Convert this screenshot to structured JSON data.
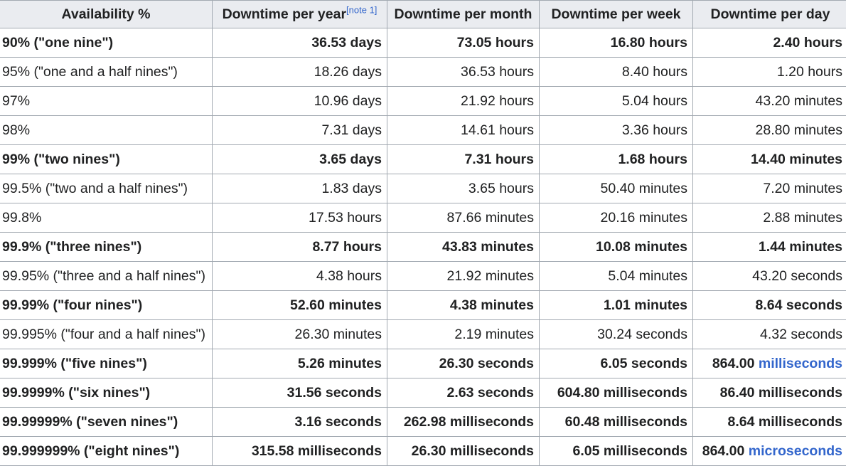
{
  "headers": [
    "Availability %",
    "Downtime per year",
    "Downtime per month",
    "Downtime per week",
    "Downtime per day"
  ],
  "note_ref": "[note 1]",
  "rows": [
    {
      "bold": true,
      "cells": [
        "90% (\"one nine\")",
        "36.53 days",
        "73.05 hours",
        "16.80 hours",
        "2.40 hours"
      ]
    },
    {
      "bold": false,
      "cells": [
        "95% (\"one and a half nines\")",
        "18.26 days",
        "36.53 hours",
        "8.40 hours",
        "1.20 hours"
      ]
    },
    {
      "bold": false,
      "cells": [
        "97%",
        "10.96 days",
        "21.92 hours",
        "5.04 hours",
        "43.20 minutes"
      ]
    },
    {
      "bold": false,
      "cells": [
        "98%",
        "7.31 days",
        "14.61 hours",
        "3.36 hours",
        "28.80 minutes"
      ]
    },
    {
      "bold": true,
      "cells": [
        "99% (\"two nines\")",
        "3.65 days",
        "7.31 hours",
        "1.68 hours",
        "14.40 minutes"
      ]
    },
    {
      "bold": false,
      "cells": [
        "99.5% (\"two and a half nines\")",
        "1.83 days",
        "3.65 hours",
        "50.40 minutes",
        "7.20 minutes"
      ]
    },
    {
      "bold": false,
      "cells": [
        "99.8%",
        "17.53 hours",
        "87.66 minutes",
        "20.16 minutes",
        "2.88 minutes"
      ]
    },
    {
      "bold": true,
      "cells": [
        "99.9% (\"three nines\")",
        "8.77 hours",
        "43.83 minutes",
        "10.08 minutes",
        "1.44 minutes"
      ]
    },
    {
      "bold": false,
      "cells": [
        "99.95% (\"three and a half nines\")",
        "4.38 hours",
        "21.92 minutes",
        "5.04 minutes",
        "43.20 seconds"
      ]
    },
    {
      "bold": true,
      "cells": [
        "99.99% (\"four nines\")",
        "52.60 minutes",
        "4.38 minutes",
        "1.01 minutes",
        "8.64 seconds"
      ]
    },
    {
      "bold": false,
      "cells": [
        "99.995% (\"four and a half nines\")",
        "26.30 minutes",
        "2.19 minutes",
        "30.24 seconds",
        "4.32 seconds"
      ]
    },
    {
      "bold": true,
      "cells": [
        "99.999% (\"five nines\")",
        "5.26 minutes",
        "26.30 seconds",
        "6.05 seconds",
        "864.00 milliseconds"
      ]
    },
    {
      "bold": true,
      "cells": [
        "99.9999% (\"six nines\")",
        "31.56 seconds",
        "2.63 seconds",
        "604.80 milliseconds",
        "86.40 milliseconds"
      ]
    },
    {
      "bold": true,
      "cells": [
        "99.99999% (\"seven nines\")",
        "3.16 seconds",
        "262.98 milliseconds",
        "60.48 milliseconds",
        "8.64 milliseconds"
      ]
    },
    {
      "bold": true,
      "cells": [
        "99.999999% (\"eight nines\")",
        "315.58 milliseconds",
        "26.30 milliseconds",
        "6.05 milliseconds",
        "864.00 microseconds"
      ]
    }
  ],
  "linked_cells": [
    {
      "row": 11,
      "col": 4,
      "prefix": "864.00 ",
      "link": "milliseconds"
    },
    {
      "row": 14,
      "col": 4,
      "prefix": "864.00 ",
      "link": "microseconds"
    }
  ],
  "colors": {
    "header_bg": "#eaecf0",
    "border": "#a2a9b1",
    "link": "#3366cc",
    "text": "#202122"
  }
}
